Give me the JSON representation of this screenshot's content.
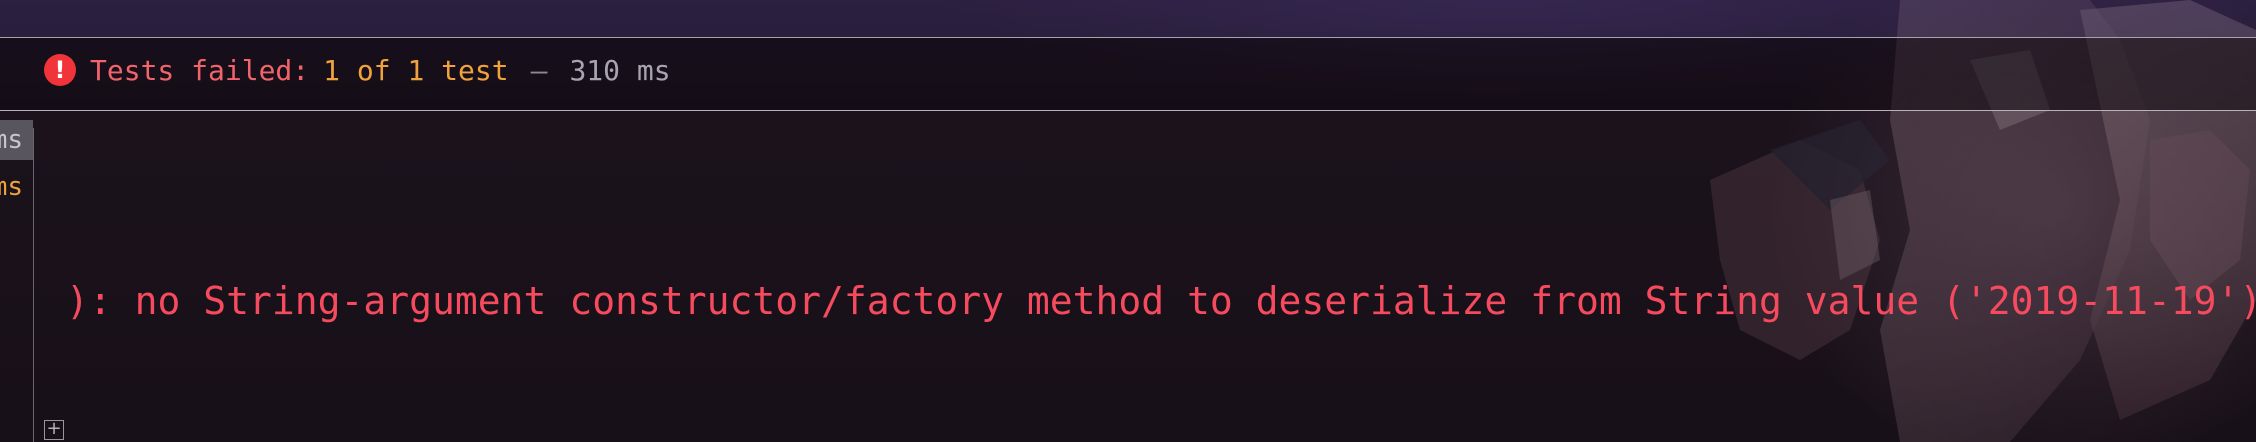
{
  "status": {
    "icon": "error-circle-icon",
    "failed_label": "Tests failed:",
    "count_label": "1 of 1 test",
    "separator": "–",
    "duration": "310 ms"
  },
  "tree": {
    "rows": [
      {
        "duration": "ms",
        "state": "selected"
      },
      {
        "duration": "ms",
        "state": "failed"
      }
    ]
  },
  "console": {
    "error_text": "): no String-argument constructor/factory method to deserialize from String value ('2019-11-19')"
  },
  "colors": {
    "failed": "#f2646b",
    "count": "#f0a23c",
    "error": "#f64a5e",
    "icon_fill": "#f0343a"
  },
  "icons": {
    "expand": "expand-plus-icon"
  }
}
